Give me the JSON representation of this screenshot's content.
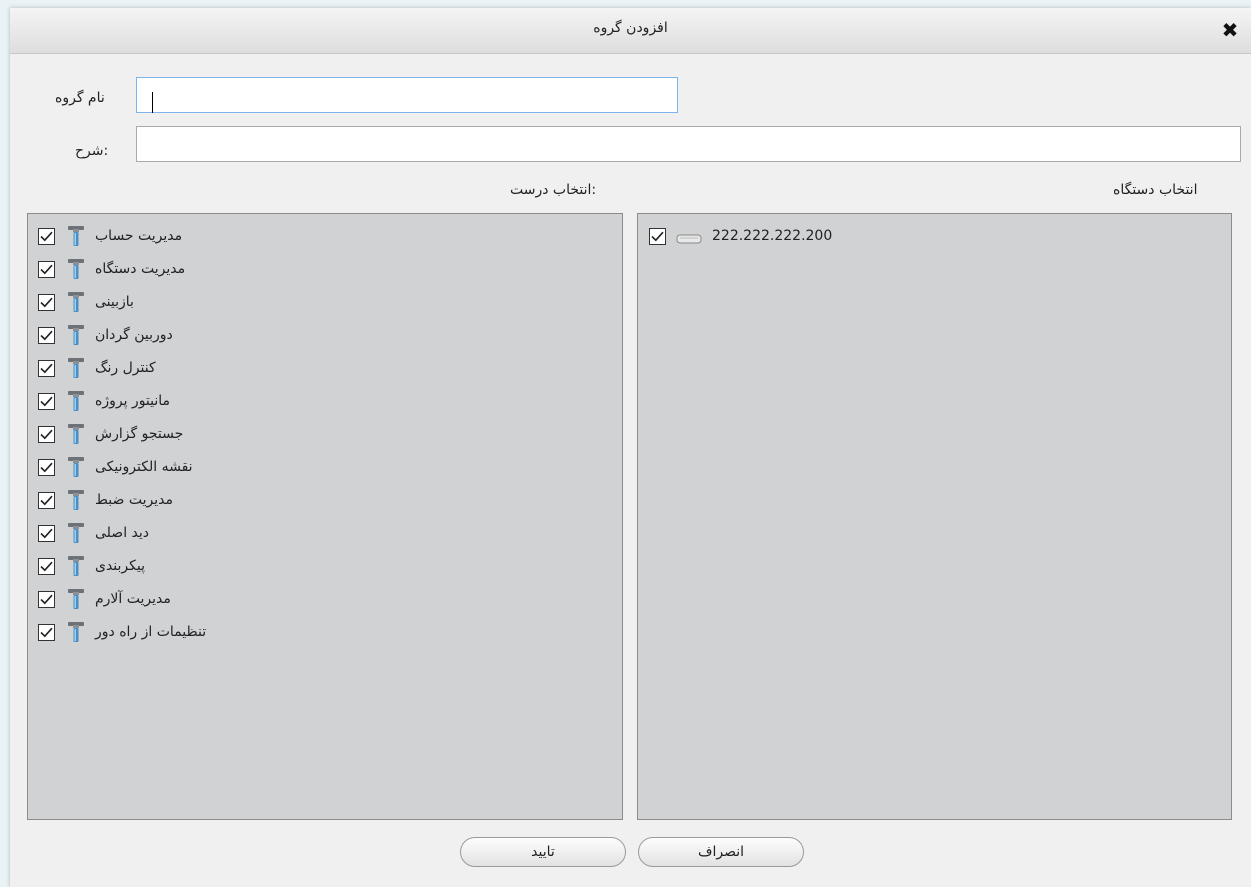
{
  "dialog": {
    "title": "افزودن گروه",
    "close_icon": "close-icon"
  },
  "form": {
    "group_name_label": "نام گروه",
    "group_name_value": "",
    "description_label": "شرح:",
    "description_value": ""
  },
  "devices": {
    "label": "انتخاب دستگاه",
    "items": [
      {
        "text": "222.222.222.200",
        "checked": true,
        "icon": "device-icon"
      }
    ]
  },
  "permissions": {
    "label": "انتخاب درست:",
    "items": [
      {
        "text": "مدیریت حساب",
        "checked": true
      },
      {
        "text": "مدیریت دستگاه",
        "checked": true
      },
      {
        "text": "بازبینی",
        "checked": true
      },
      {
        "text": "دوربین گردان",
        "checked": true
      },
      {
        "text": "کنترل رنگ",
        "checked": true
      },
      {
        "text": "مانیتور پروژه",
        "checked": true
      },
      {
        "text": "جستجو گزارش",
        "checked": true
      },
      {
        "text": "نقشه الکترونیکی",
        "checked": true
      },
      {
        "text": "مدیریت ضبط",
        "checked": true
      },
      {
        "text": "دید اصلی",
        "checked": true
      },
      {
        "text": "پیکربندی",
        "checked": true
      },
      {
        "text": "مدیریت آلارم",
        "checked": true
      },
      {
        "text": "تنظیمات از راه دور",
        "checked": true
      }
    ]
  },
  "buttons": {
    "confirm": "تایید",
    "cancel": "انصراف"
  },
  "colors": {
    "panel_bg": "#d1d2d4",
    "dialog_bg": "#f0f0f0",
    "focus_border": "#7eb4ea",
    "permission_icon": "#4a90c8"
  }
}
